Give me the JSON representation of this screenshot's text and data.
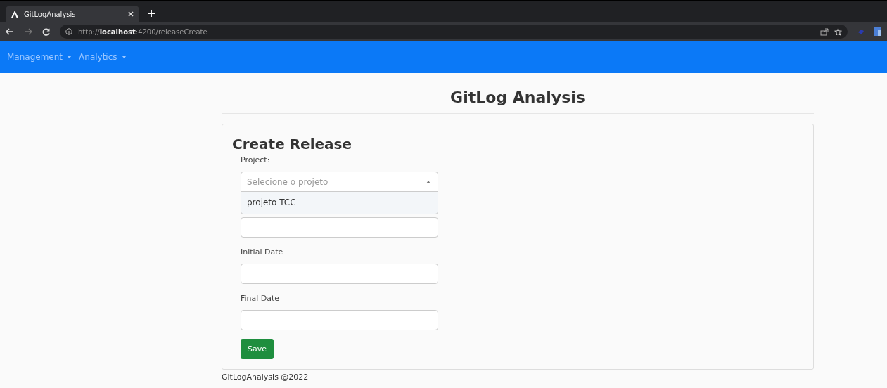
{
  "browser": {
    "tab_title": "GitLogAnalysis",
    "url_prefix": "http://",
    "url_host": "localhost",
    "url_rest": ":4200/releaseCreate"
  },
  "navbar": {
    "menus": [
      {
        "label": "Management"
      },
      {
        "label": "Analytics"
      }
    ]
  },
  "title": "GitLog Analysis",
  "form": {
    "heading": "Create Release",
    "fields": [
      {
        "kind": "select",
        "label": "Project:",
        "placeholder": "Selecione o projeto",
        "expanded": true,
        "options": [
          "projeto TCC"
        ]
      },
      {
        "kind": "text"
      },
      {
        "kind": "text",
        "label": "Initial Date"
      },
      {
        "kind": "text",
        "label": "Final Date"
      }
    ],
    "button": "Save"
  },
  "footer": "GitLogAnalysis @2022"
}
